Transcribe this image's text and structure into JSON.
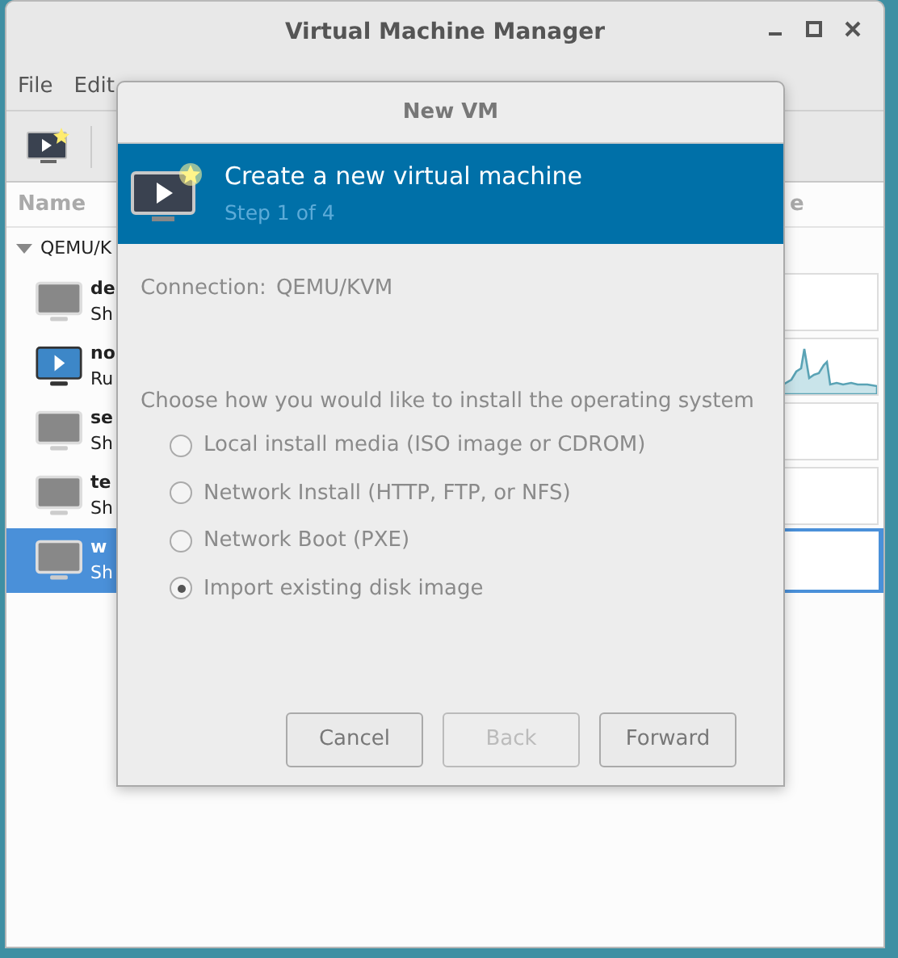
{
  "window": {
    "title": "Virtual Machine Manager"
  },
  "menu": [
    "File",
    "Edit"
  ],
  "list_header": {
    "name_column": "Name",
    "column_2": "e"
  },
  "connection_group": {
    "label": "QEMU/K",
    "expanded": true
  },
  "vms": [
    {
      "name": "de",
      "status": "Sh",
      "running": false,
      "selected": false
    },
    {
      "name": "no",
      "status": "Ru",
      "running": true,
      "selected": false
    },
    {
      "name": "se",
      "status": "Sh",
      "running": false,
      "selected": false
    },
    {
      "name": "te",
      "status": "Sh",
      "running": false,
      "selected": false
    },
    {
      "name": "w",
      "status": "Sh",
      "running": false,
      "selected": true
    }
  ],
  "dialog": {
    "title": "New VM",
    "banner": {
      "title": "Create a new virtual machine",
      "subtitle": "Step 1 of 4"
    },
    "connection": {
      "label": "Connection:",
      "value": "QEMU/KVM"
    },
    "prompt": "Choose how you would like to install the operating system",
    "options": [
      {
        "label": "Local install media (ISO image or CDROM)",
        "selected": false
      },
      {
        "label": "Network Install (HTTP, FTP, or NFS)",
        "selected": false
      },
      {
        "label": "Network Boot (PXE)",
        "selected": false
      },
      {
        "label": "Import existing disk image",
        "selected": true
      }
    ],
    "buttons": [
      {
        "label": "Cancel",
        "disabled": false
      },
      {
        "label": "Back",
        "disabled": true
      },
      {
        "label": "Forward",
        "disabled": false
      }
    ]
  }
}
